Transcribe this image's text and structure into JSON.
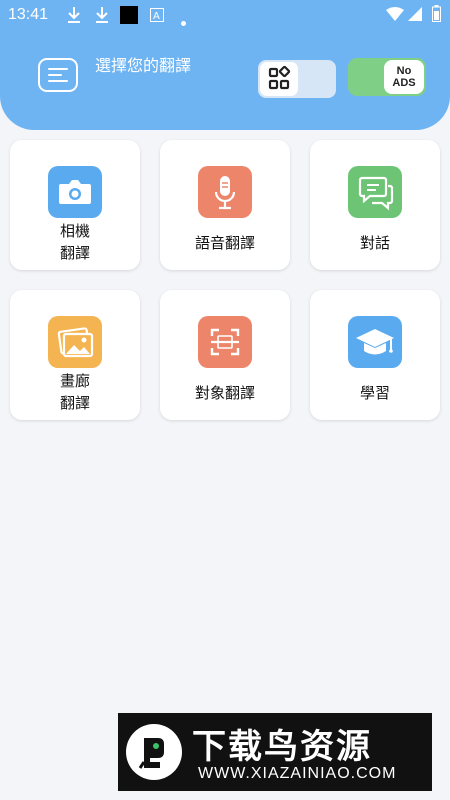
{
  "status_bar": {
    "time": "13:41",
    "icons": [
      "download-icon",
      "download-icon",
      "black-square-icon",
      "text-icon",
      "dot-icon",
      "wifi-icon",
      "signal-icon",
      "battery-icon"
    ]
  },
  "header": {
    "title": "選擇您的翻譯",
    "no_ads_line1": "No",
    "no_ads_line2": "ADS",
    "colors": {
      "header_bg": "#6fb4f2",
      "toggle_on": "#7fcf86"
    }
  },
  "features": [
    {
      "line1": "相機",
      "line2": "翻譯",
      "icon": "camera-icon",
      "color": "#5aaaf0"
    },
    {
      "line1": "語音翻譯",
      "icon": "microphone-icon",
      "color": "#ec8569"
    },
    {
      "line1": "對話",
      "icon": "chat-icon",
      "color": "#6cc474"
    },
    {
      "line1": "畫廊",
      "line2": "翻譯",
      "icon": "gallery-icon",
      "color": "#f4b451"
    },
    {
      "line1": "對象翻譯",
      "icon": "scan-object-icon",
      "color": "#ec8569"
    },
    {
      "line1": "學習",
      "icon": "graduation-cap-icon",
      "color": "#5aaaf0"
    }
  ],
  "banner": {
    "brand": "下载鸟资源",
    "url": "WWW.XIAZAINIAO.COM"
  }
}
